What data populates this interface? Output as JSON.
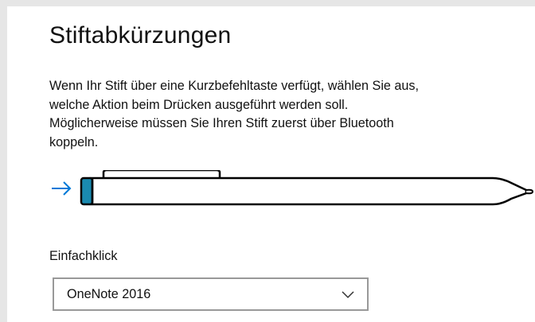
{
  "section": {
    "title": "Stiftabkürzungen",
    "description_lines": [
      "Wenn Ihr Stift über eine Kurzbefehltaste verfügt, wählen Sie aus,",
      "welche Aktion beim Drücken ausgeführt werden soll.",
      "Möglicherweise müssen Sie Ihren Stift zuerst über Bluetooth",
      "koppeln."
    ]
  },
  "illustration": {
    "icon": "pen-with-shortcut-button-icon",
    "arrow_icon": "arrow-right-icon",
    "arrow_color": "#0078d7",
    "button_color": "#1a8ab0"
  },
  "single_click": {
    "label": "Einfachklick",
    "selected_value": "OneNote 2016",
    "chevron_icon": "chevron-down-icon"
  }
}
